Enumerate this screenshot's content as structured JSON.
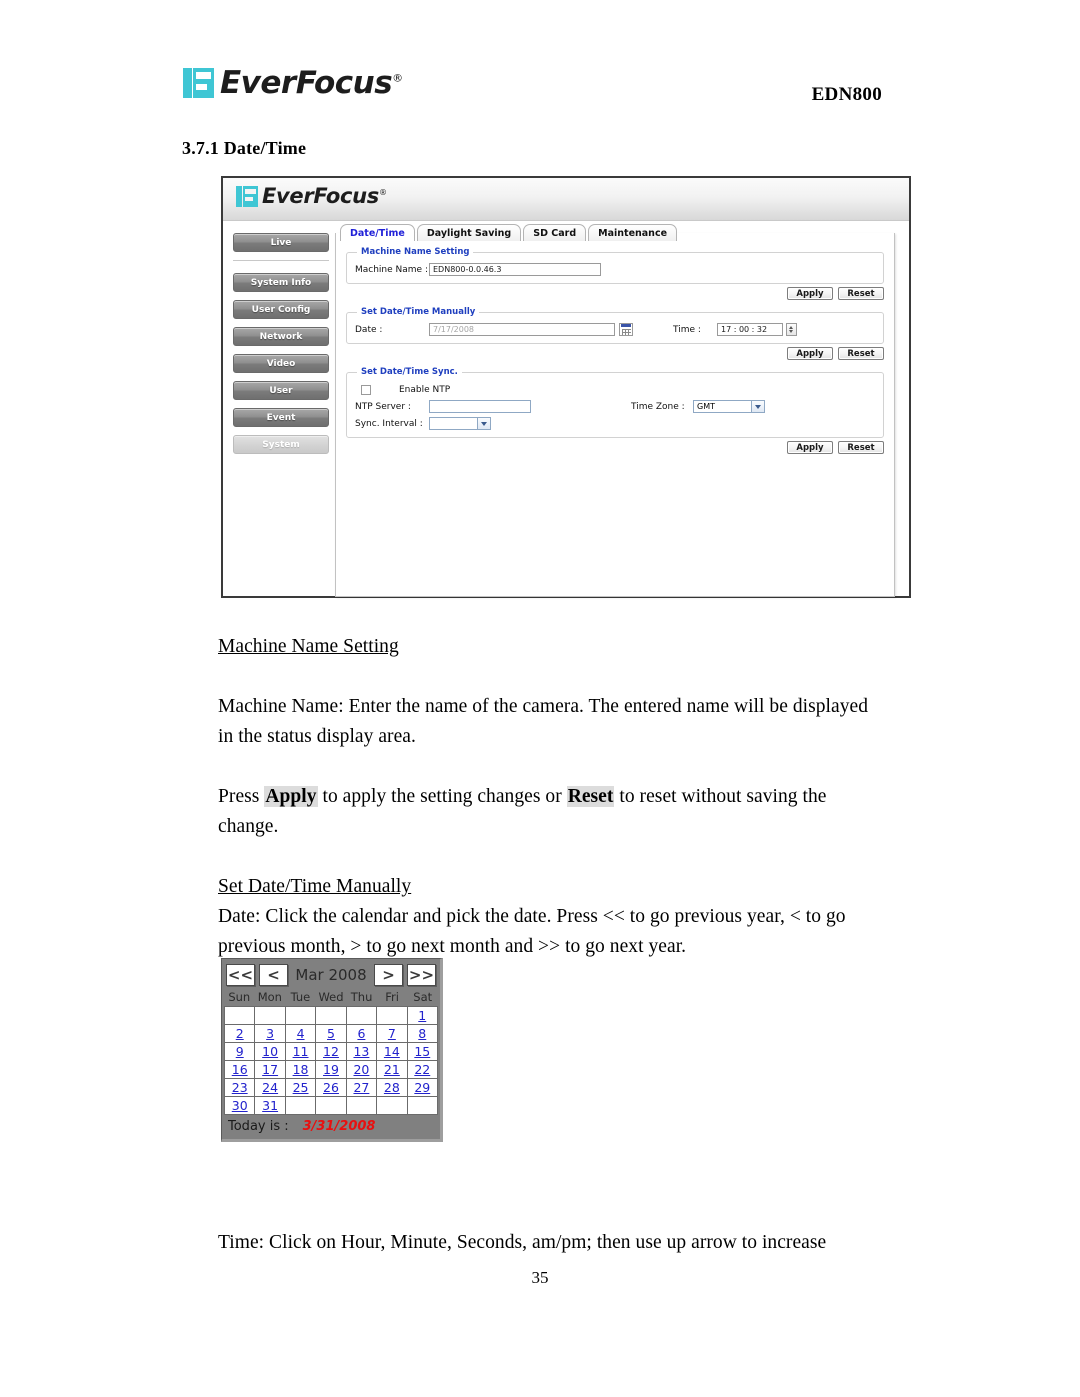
{
  "document": {
    "brand": "EverFocus",
    "brand_registered": "®",
    "model": "EDN800",
    "section_number": "3.7.1",
    "section_title": "3.7.1 Date/Time",
    "page_number": "35"
  },
  "screenshot": {
    "banner_brand": "EverFocus",
    "banner_registered": "®",
    "sidebar": {
      "items": [
        {
          "label": "Live",
          "state": "normal"
        },
        {
          "label": "System Info",
          "state": "normal"
        },
        {
          "label": "User Config",
          "state": "normal"
        },
        {
          "label": "Network",
          "state": "normal"
        },
        {
          "label": "Video",
          "state": "normal"
        },
        {
          "label": "User",
          "state": "normal"
        },
        {
          "label": "Event",
          "state": "normal"
        },
        {
          "label": "System",
          "state": "active"
        }
      ]
    },
    "tabs": [
      {
        "label": "Date/Time",
        "active": true
      },
      {
        "label": "Daylight Saving",
        "active": false
      },
      {
        "label": "SD Card",
        "active": false
      },
      {
        "label": "Maintenance",
        "active": false
      }
    ],
    "machine_name_section": {
      "legend": "Machine Name Setting",
      "machine_name_label": "Machine Name :",
      "machine_name_value": "EDN800-0.0.46.3",
      "apply_label": "Apply",
      "reset_label": "Reset"
    },
    "manual_section": {
      "legend": "Set Date/Time Manually",
      "date_label": "Date :",
      "date_value": "7/17/2008",
      "time_label": "Time :",
      "time_value": "17 : 00 : 32",
      "apply_label": "Apply",
      "reset_label": "Reset"
    },
    "sync_section": {
      "legend": "Set Date/Time Sync.",
      "enable_ntp_label": "Enable NTP",
      "enable_ntp_checked": false,
      "ntp_server_label": "NTP Server :",
      "ntp_server_value": "",
      "sync_interval_label": "Sync. Interval :",
      "sync_interval_value": "",
      "time_zone_label": "Time Zone :",
      "time_zone_value": "GMT",
      "apply_label": "Apply",
      "reset_label": "Reset"
    },
    "accent_colors": {
      "legend_blue": "#1f3fbf",
      "active_tab_blue": "#2020d8",
      "logo_cyan": "#3fc6d4"
    }
  },
  "body": {
    "heading_1": "Machine Name Setting",
    "para_1": "Machine Name: Enter the name of the camera. The entered name will be displayed in the status display area.",
    "para_2_before": "Press ",
    "para_2_apply": "Apply",
    "para_2_middle": " to apply the setting changes or ",
    "para_2_reset": "Reset",
    "para_2_after": " to reset without saving the change.",
    "heading_2": "Set Date/Time Manually",
    "para_3": "Date: Click the calendar and pick the date. Press << to go previous year, < to go previous month, > to go next month and >> to go next year.",
    "para_4": "Time: Click on Hour, Minute, Seconds, am/pm; then use up arrow to increase"
  },
  "calendar": {
    "prev_year_label": "<<",
    "prev_month_label": "<",
    "title": "Mar 2008",
    "next_month_label": ">",
    "next_year_label": ">>",
    "day_headers": [
      "Sun",
      "Mon",
      "Tue",
      "Wed",
      "Thu",
      "Fri",
      "Sat"
    ],
    "weeks": [
      [
        "",
        "",
        "",
        "",
        "",
        "",
        "1"
      ],
      [
        "2",
        "3",
        "4",
        "5",
        "6",
        "7",
        "8"
      ],
      [
        "9",
        "10",
        "11",
        "12",
        "13",
        "14",
        "15"
      ],
      [
        "16",
        "17",
        "18",
        "19",
        "20",
        "21",
        "22"
      ],
      [
        "23",
        "24",
        "25",
        "26",
        "27",
        "28",
        "29"
      ],
      [
        "30",
        "31",
        "",
        "",
        "",
        "",
        ""
      ]
    ],
    "today_label": "Today is :",
    "today_value": "3/31/2008",
    "today_color": "#e81010"
  }
}
